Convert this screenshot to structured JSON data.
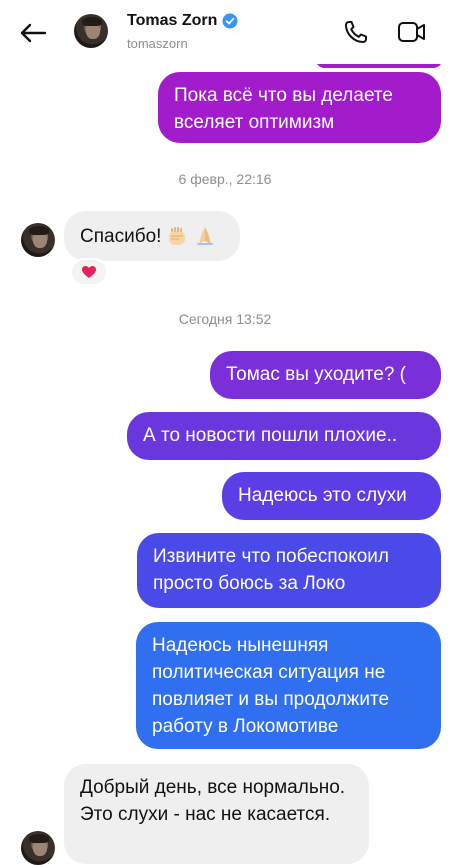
{
  "header": {
    "contact_name": "Tomas Zorn",
    "username": "tomaszorn",
    "verified": true,
    "icons": [
      "back-arrow-icon",
      "verified-badge-icon",
      "phone-icon",
      "video-call-icon"
    ]
  },
  "messages": {
    "m1": "Пока всё что вы делаете вселяет оптимизм",
    "ts1": "6 февр., 22:16",
    "m2": "Спасибо!",
    "m2_emojis": [
      "raised-fist-icon",
      "folded-hands-icon"
    ],
    "m2_reaction": "heart-icon",
    "ts2": "Сегодня 13:52",
    "m3": "Томас вы уходите? (",
    "m4": "А то новости пошли плохие..",
    "m5": "Надеюсь это слухи",
    "m6": "Извините что побеспокоил просто боюсь за Локо",
    "m7": "Надеюсь нынешняя политическая ситуация не повлияет и вы продолжите работу в Локомотиве",
    "m8": "Добрый день, все нормально. Это слухи - нас не касается."
  },
  "colors": {
    "bubble_purple": "#a21ccc",
    "bubble_violet": "#7b2fd8",
    "bubble_indigo": "#5b3ee6",
    "bubble_blue": "#3f57ea",
    "bubble_azure": "#2f6ff0",
    "incoming_bg": "#efefef",
    "timestamp": "#8e8e8e",
    "heart": "#e0245e",
    "verified": "#3897f0"
  }
}
